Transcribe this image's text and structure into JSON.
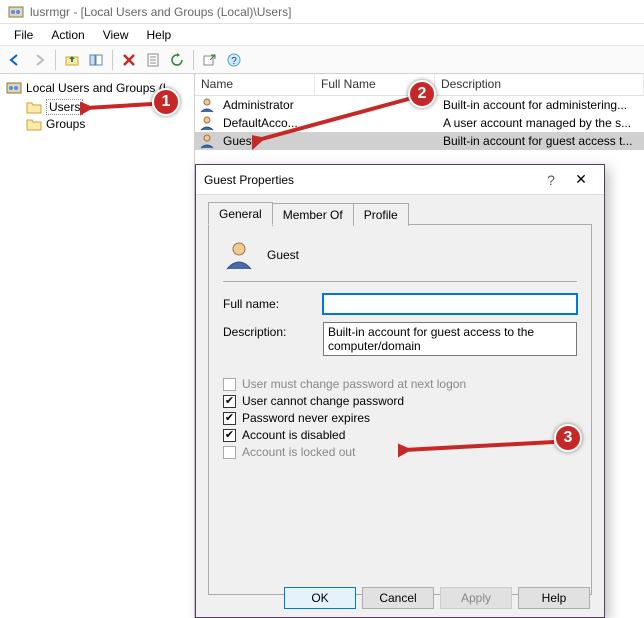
{
  "window": {
    "title": "lusrmgr - [Local Users and Groups (Local)\\Users]"
  },
  "menus": [
    "File",
    "Action",
    "View",
    "Help"
  ],
  "tree": {
    "root": "Local Users and Groups (L",
    "items": [
      {
        "label": "Users",
        "selected": true
      },
      {
        "label": "Groups",
        "selected": false
      }
    ]
  },
  "list": {
    "columns": {
      "name": "Name",
      "fullname": "Full Name",
      "description": "Description"
    },
    "rows": [
      {
        "name": "Administrator",
        "fullname": "",
        "description": "Built-in account for administering..."
      },
      {
        "name": "DefaultAcco...",
        "fullname": "",
        "description": "A user account managed by the s..."
      },
      {
        "name": "Guest",
        "fullname": "",
        "description": "Built-in account for guest access t...",
        "selected": true
      }
    ]
  },
  "dialog": {
    "title": "Guest Properties",
    "tabs": [
      "General",
      "Member Of",
      "Profile"
    ],
    "active_tab": 0,
    "user_display": "Guest",
    "labels": {
      "fullname": "Full name:",
      "description": "Description:"
    },
    "fields": {
      "fullname": "",
      "description": "Built-in account for guest access to the computer/domain"
    },
    "checkboxes": [
      {
        "label": "User must change password at next logon",
        "checked": false,
        "enabled": false
      },
      {
        "label": "User cannot change password",
        "checked": true,
        "enabled": true
      },
      {
        "label": "Password never expires",
        "checked": true,
        "enabled": true
      },
      {
        "label": "Account is disabled",
        "checked": true,
        "enabled": true
      },
      {
        "label": "Account is locked out",
        "checked": false,
        "enabled": false
      }
    ],
    "buttons": {
      "ok": "OK",
      "cancel": "Cancel",
      "apply": "Apply",
      "help": "Help"
    }
  },
  "annotations": {
    "1": "1",
    "2": "2",
    "3": "3"
  }
}
